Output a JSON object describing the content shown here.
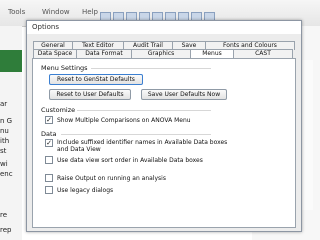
{
  "app_menu": {
    "items": [
      "Tools",
      "Window",
      "Help"
    ]
  },
  "background": {
    "left_fragments": [
      "ar",
      "n G",
      "nu",
      "ith",
      "st",
      "wi",
      "enc",
      "re"
    ],
    "bottom_label": "rep"
  },
  "dialog": {
    "title": "Options",
    "tabs_row1": [
      "General",
      "Text Editor",
      "Audit Trail",
      "Save",
      "Fonts and Colours"
    ],
    "tabs_row2": [
      "Data Space",
      "Data Format",
      "Graphics",
      "Menus",
      "CAST"
    ],
    "active_tab": "Menus",
    "menu_settings": {
      "label": "Menu Settings",
      "reset_genstat": "Reset to GenStat Defaults",
      "reset_user": "Reset to User Defaults",
      "save_user": "Save User Defaults Now"
    },
    "customize": {
      "label": "Customize",
      "show_multiple": "Show Multiple Comparisons on ANOVA Menu",
      "show_multiple_checked": true
    },
    "data": {
      "label": "Data",
      "include_suffixed": "Include suffixed identifier names in Available Data boxes and Data View",
      "include_suffixed_checked": true,
      "use_sort_order": "Use data view sort order in Available Data boxes",
      "use_sort_order_checked": false
    },
    "raise_output": "Raise Output on running an analysis",
    "raise_output_checked": false,
    "use_legacy": "Use legacy dialogs",
    "use_legacy_checked": false
  }
}
